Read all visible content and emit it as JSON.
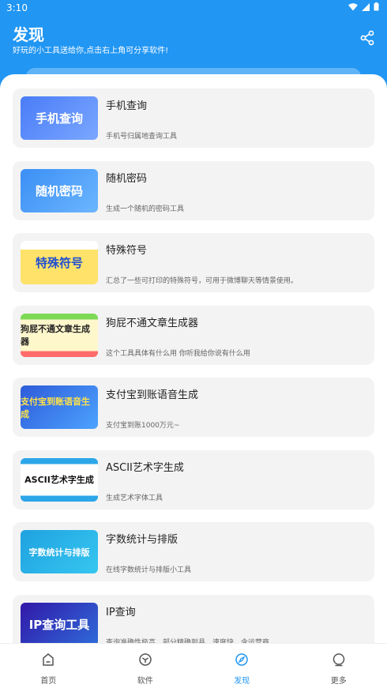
{
  "status": {
    "time": "3:10"
  },
  "header": {
    "title": "发现",
    "subtitle": "好玩的小工具送给你,点击右上角可分享软件!"
  },
  "colors": {
    "primary": "#2196f3",
    "card_bg": "#f3f3f3"
  },
  "tools": [
    {
      "title": "手机查询",
      "desc": "手机号归属地查询工具",
      "thumb_text": "手机查询"
    },
    {
      "title": "随机密码",
      "desc": "生成一个随机的密码工具",
      "thumb_text": "随机密码"
    },
    {
      "title": "特殊符号",
      "desc": "汇总了一些可打印的特殊符号，可用于微博聊天等情景使用。",
      "thumb_text": "特殊符号"
    },
    {
      "title": "狗屁不通文章生成器",
      "desc": "这个工具具体有什么用 你听我给你说有什么用",
      "thumb_text": "狗屁不通文章生成器"
    },
    {
      "title": "支付宝到账语音生成",
      "desc": "支付宝到账1000万元~",
      "thumb_text": "支付宝到账语音生成"
    },
    {
      "title": "ASCII艺术字生成",
      "desc": "生成艺术字体工具",
      "thumb_text": "ASCII艺术字生成"
    },
    {
      "title": "字数统计与排版",
      "desc": "在线字数统计与排版小工具",
      "thumb_text": "字数统计与排版"
    },
    {
      "title": "IP查询",
      "desc": "查询准确性极高，部分精确到县，速度快，含运营商",
      "thumb_text": "IP查询工具"
    }
  ],
  "nav": [
    {
      "label": "首页",
      "icon": "home-icon"
    },
    {
      "label": "软件",
      "icon": "apps-icon"
    },
    {
      "label": "发现",
      "icon": "compass-icon",
      "active": true
    },
    {
      "label": "更多",
      "icon": "more-icon"
    }
  ]
}
